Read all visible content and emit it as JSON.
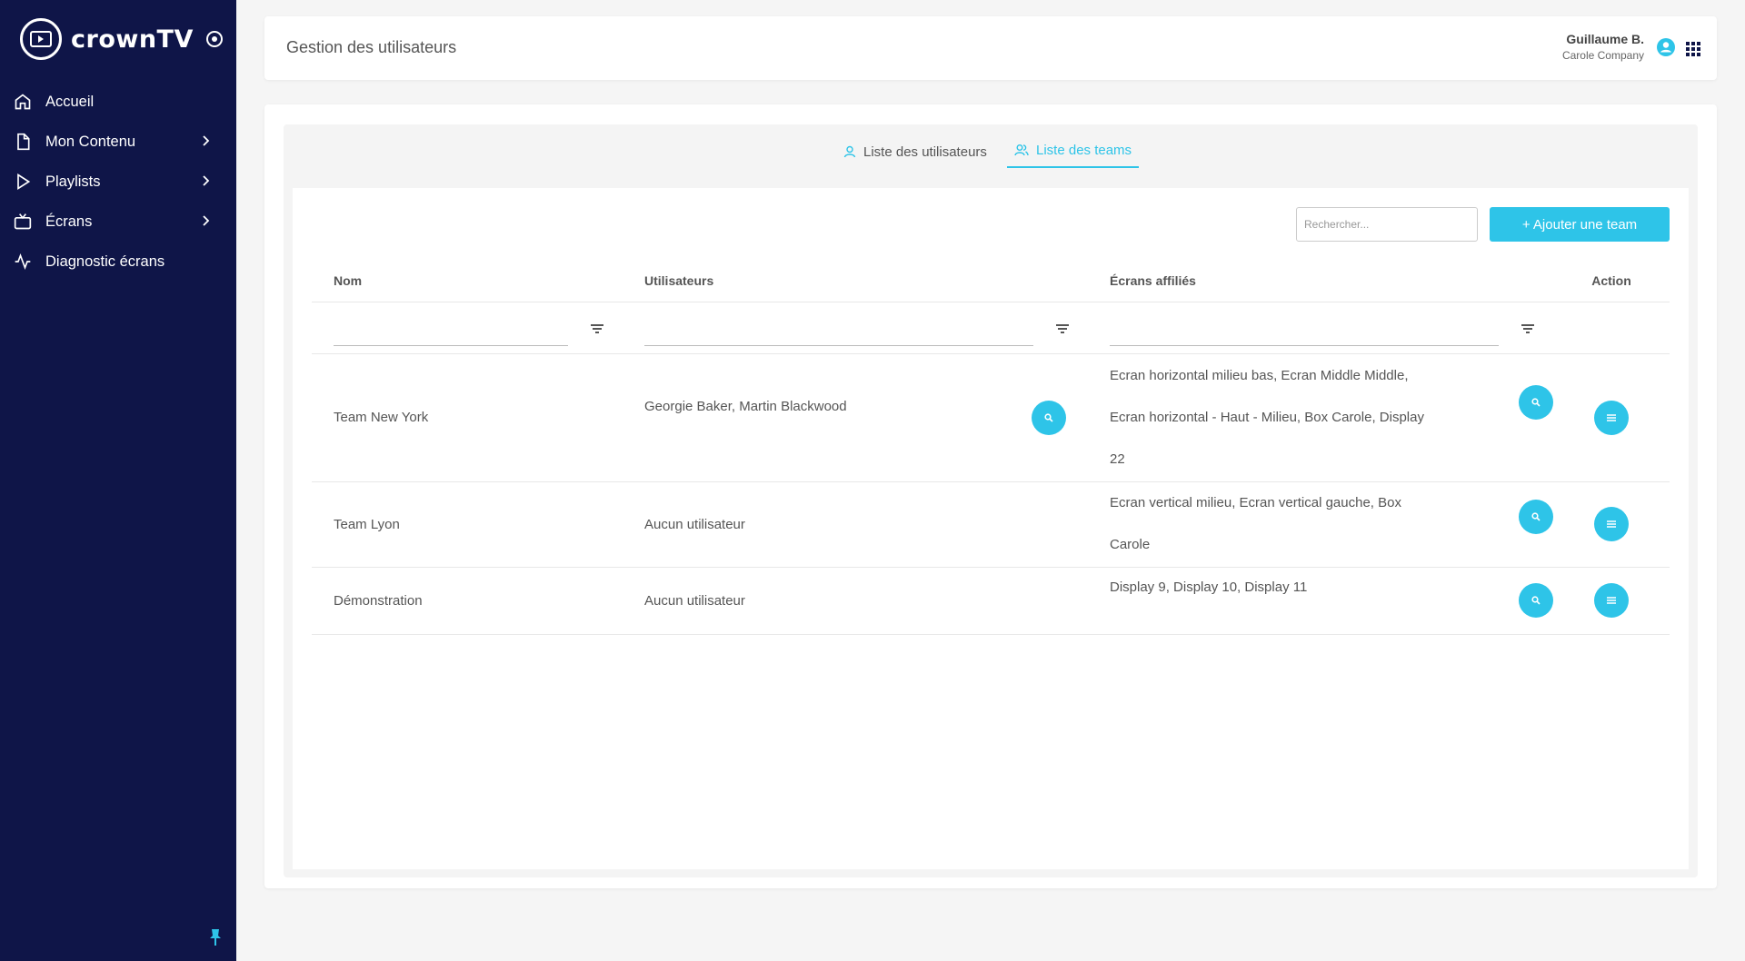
{
  "sidebar": {
    "brand": "crownTV",
    "items": [
      {
        "label": "Accueil",
        "icon": "home-icon"
      },
      {
        "label": "Mon Contenu",
        "icon": "file-icon"
      },
      {
        "label": "Playlists",
        "icon": "play-icon"
      },
      {
        "label": "Écrans",
        "icon": "tv-icon"
      },
      {
        "label": "Diagnostic écrans",
        "icon": "activity-icon"
      }
    ]
  },
  "header": {
    "title": "Gestion des utilisateurs",
    "user_name": "Guillaume B.",
    "company": "Carole Company"
  },
  "tabs": [
    {
      "label": "Liste des utilisateurs",
      "active": false
    },
    {
      "label": "Liste des teams",
      "active": true
    }
  ],
  "toolbar": {
    "search_placeholder": "Rechercher...",
    "add_label": "+ Ajouter une team"
  },
  "table": {
    "columns": [
      "Nom",
      "Utilisateurs",
      "Écrans affiliés",
      "Action"
    ],
    "rows": [
      {
        "name": "Team New York",
        "users": "Georgie Baker,  Martin Blackwood",
        "screens": "Ecran horizontal milieu bas,  Ecran Middle Middle,  Ecran horizontal - Haut - Milieu,  Box Carole,  Display 22"
      },
      {
        "name": "Team Lyon",
        "users": "Aucun utilisateur",
        "screens": "Ecran vertical milieu,  Ecran vertical gauche,  Box Carole"
      },
      {
        "name": "Démonstration",
        "users": "Aucun utilisateur",
        "screens": "Display 9,  Display 10,  Display 11"
      }
    ]
  },
  "colors": {
    "sidebar": "#0f1548",
    "accent": "#2ec4e8"
  }
}
